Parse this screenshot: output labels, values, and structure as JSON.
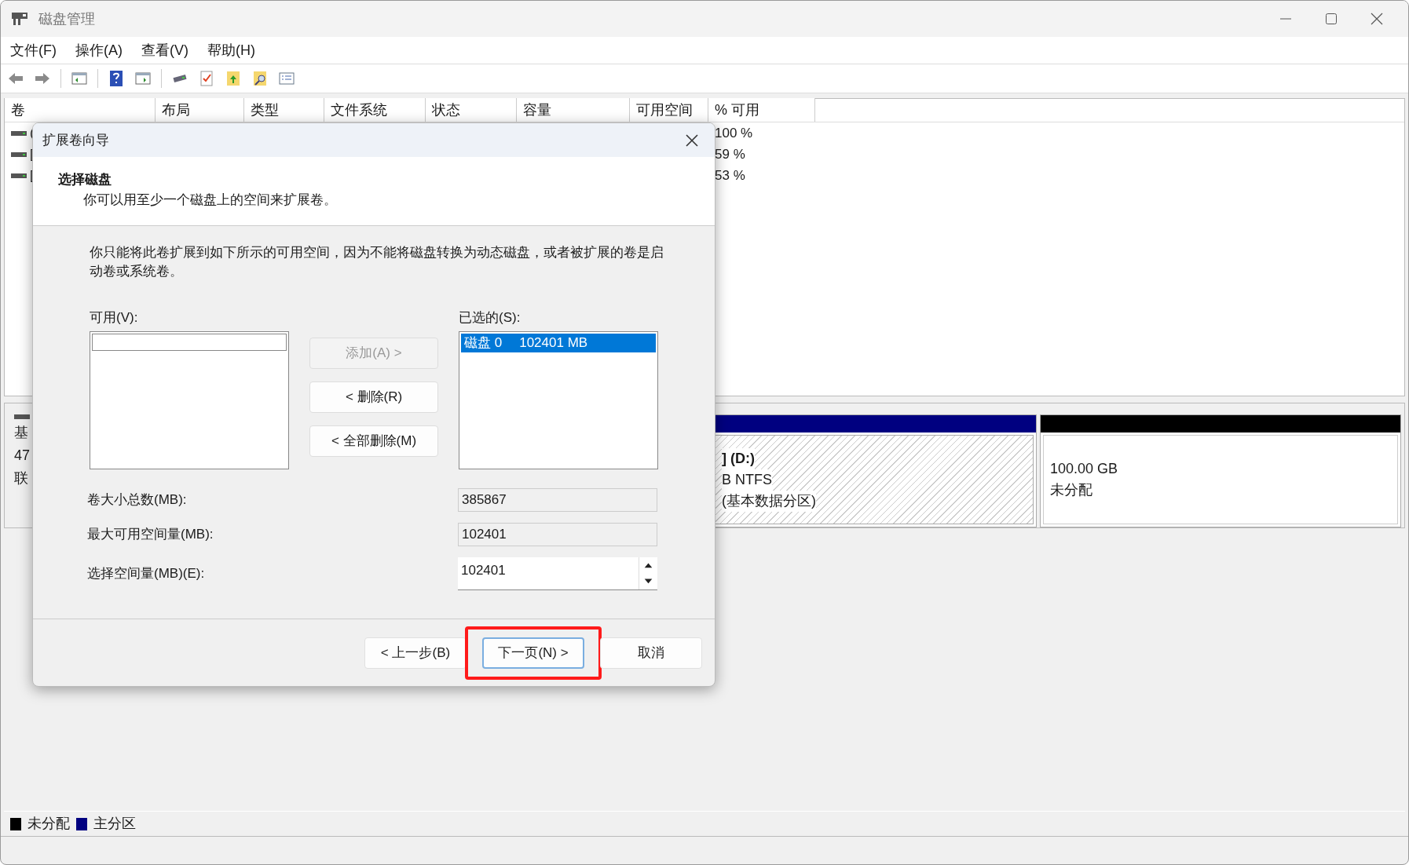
{
  "window": {
    "title": "磁盘管理"
  },
  "menu": [
    "文件(F)",
    "操作(A)",
    "查看(V)",
    "帮助(H)"
  ],
  "volume_list": {
    "columns": [
      "卷",
      "布局",
      "类型",
      "文件系统",
      "状态",
      "容量",
      "可用空间",
      "% 可用"
    ],
    "rows": [
      {
        "volume": "(",
        "percent_free": "100 %"
      },
      {
        "volume": "[",
        "percent_free": "59 %"
      },
      {
        "volume": "[",
        "percent_free": "53 %"
      }
    ]
  },
  "disk_map": {
    "disk_label": [
      "基",
      "47",
      "联"
    ],
    "partitions": [
      {
        "kind": "primary",
        "lines": [
          "]  (D:)",
          "B NTFS",
          "(基本数据分区)"
        ]
      },
      {
        "kind": "unallocated",
        "lines": [
          "100.00 GB",
          "未分配"
        ]
      }
    ]
  },
  "legend": [
    {
      "label": "未分配",
      "color": "#000000"
    },
    {
      "label": "主分区",
      "color": "#000080"
    }
  ],
  "dialog": {
    "title": "扩展卷向导",
    "heading": "选择磁盘",
    "subheading": "你可以用至少一个磁盘上的空间来扩展卷。",
    "description": "你只能将此卷扩展到如下所示的可用空间，因为不能将磁盘转换为动态磁盘，或者被扩展的卷是启动卷或系统卷。",
    "available": {
      "label": "可用(V):"
    },
    "chosen": {
      "label": "已选的(S):",
      "items": [
        {
          "disk": "磁盘 0",
          "size": "102401 MB",
          "selected": true
        }
      ]
    },
    "move_buttons": [
      {
        "label": "添加(A) >",
        "disabled": true
      },
      {
        "label": "< 删除(R)",
        "disabled": false
      },
      {
        "label": "< 全部删除(M)",
        "disabled": false
      }
    ],
    "fields": [
      {
        "kind": "readonly",
        "label": "卷大小总数(MB):",
        "value": "385867"
      },
      {
        "kind": "readonly",
        "label": "最大可用空间量(MB):",
        "value": "102401"
      },
      {
        "kind": "spin",
        "label": "选择空间量(MB)(E):",
        "value": "102401"
      }
    ],
    "buttons": [
      {
        "label": "< 上一步(B)",
        "focused": false,
        "highlighted": false
      },
      {
        "label": "下一页(N) >",
        "focused": true,
        "highlighted": true
      },
      {
        "label": "取消",
        "focused": false,
        "highlighted": false
      }
    ]
  }
}
